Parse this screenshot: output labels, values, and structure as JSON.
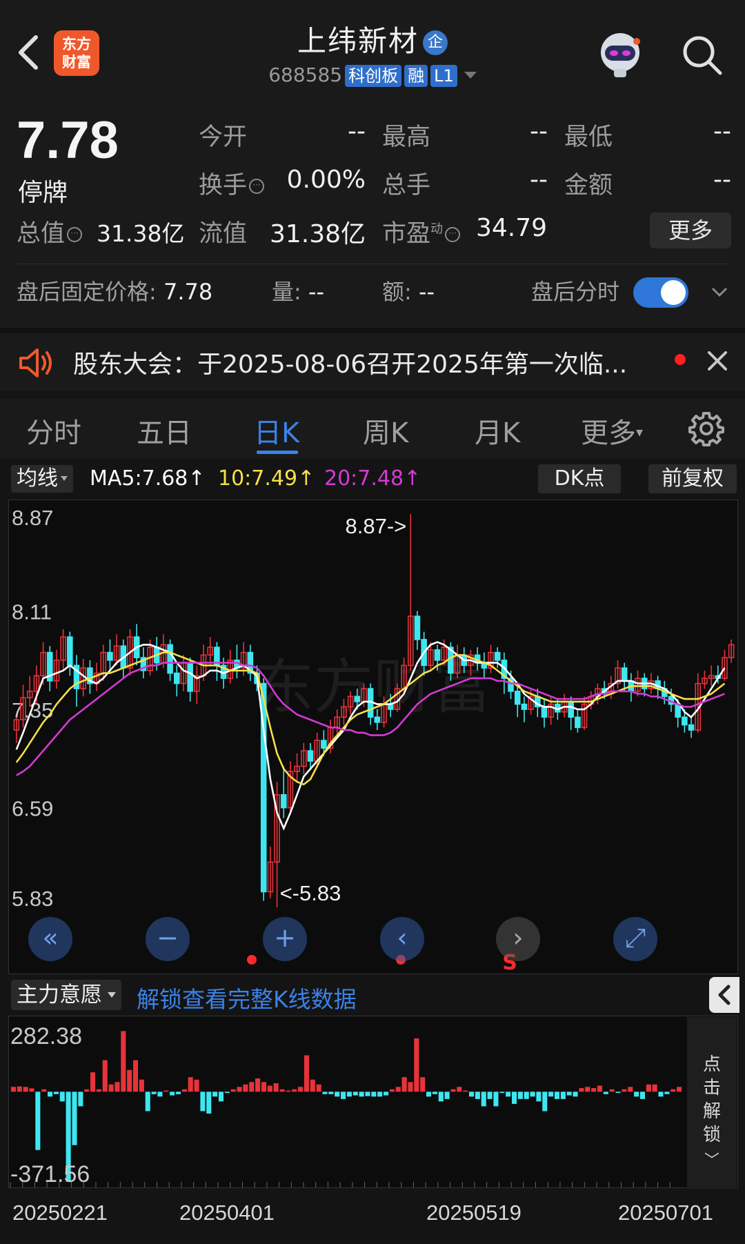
{
  "header": {
    "title": "上纬新材",
    "title_badge": "企",
    "code": "688585",
    "tags": [
      "科创板",
      "融",
      "L1"
    ],
    "logo_text_line1": "东方",
    "logo_text_line2": "财富"
  },
  "quote": {
    "price": "7.78",
    "status": "停牌",
    "fields": {
      "open_label": "今开",
      "open_value": "--",
      "high_label": "最高",
      "high_value": "--",
      "low_label": "最低",
      "low_value": "--",
      "turnover_label": "换手",
      "turnover_value": "0.00%",
      "volume_label": "总手",
      "volume_value": "--",
      "amount_label": "金额",
      "amount_value": "--",
      "mcap_label": "总值",
      "mcap_value": "31.38亿",
      "float_label": "流值",
      "float_value": "31.38亿",
      "pe_label": "市盈",
      "pe_sup": "动",
      "pe_value": "34.79"
    },
    "more_label": "更多",
    "after_hours": {
      "price_label": "盘后固定价格:",
      "price_value": "7.78",
      "vol_label": "量:",
      "vol_value": "--",
      "amt_label": "额:",
      "amt_value": "--",
      "timeshare_label": "盘后分时",
      "toggle_on": true
    }
  },
  "notice": {
    "text": "股东大会：于2025-08-06召开2025年第一次临...",
    "unread_color": "#ff2020"
  },
  "tabs": [
    {
      "label": "分时",
      "active": false
    },
    {
      "label": "五日",
      "active": false
    },
    {
      "label": "日K",
      "active": true
    },
    {
      "label": "周K",
      "active": false
    },
    {
      "label": "月K",
      "active": false
    },
    {
      "label": "更多",
      "active": false
    }
  ],
  "chart_toolbar": {
    "ma_button": "均线",
    "ma5": "MA5:7.68↑",
    "ma10": "10:7.49↑",
    "ma20": "20:7.48↑",
    "ma5_color": "#ffffff",
    "ma10_color": "#f5e04a",
    "ma20_color": "#d43ad4",
    "dk_button": "DK点",
    "adjust_button": "前复权"
  },
  "kline": {
    "y_labels": [
      "8.87",
      "8.11",
      "7.35",
      "6.59",
      "5.83"
    ],
    "max_marker": "8.87->",
    "min_marker": "<-5.83",
    "watermark": "东方财富",
    "up_color": "#e8333a",
    "down_color": "#3ee6f0"
  },
  "indicator": {
    "name": "主力意愿",
    "unlock_text": "解锁查看完整K线数据",
    "y_max": "282.38",
    "y_min": "-371.56",
    "side_text": "点击解锁"
  },
  "dates": [
    "20250221",
    "20250401",
    "20250519",
    "20250701"
  ],
  "chart_data": {
    "type": "candlestick",
    "y_range": [
      5.83,
      8.87
    ],
    "candles": [
      [
        7.2,
        7.28,
        7.3,
        7.1
      ],
      [
        7.28,
        7.45,
        7.55,
        7.22
      ],
      [
        7.45,
        7.5,
        7.62,
        7.38
      ],
      [
        7.5,
        7.62,
        7.7,
        7.4
      ],
      [
        7.62,
        7.8,
        7.88,
        7.55
      ],
      [
        7.8,
        7.58,
        7.85,
        7.5
      ],
      [
        7.58,
        7.74,
        7.82,
        7.52
      ],
      [
        7.74,
        7.92,
        7.98,
        7.66
      ],
      [
        7.92,
        7.7,
        7.96,
        7.62
      ],
      [
        7.7,
        7.52,
        7.78,
        7.38
      ],
      [
        7.52,
        7.68,
        7.75,
        7.46
      ],
      [
        7.68,
        7.56,
        7.74,
        7.48
      ],
      [
        7.56,
        7.64,
        7.72,
        7.5
      ],
      [
        7.64,
        7.8,
        7.86,
        7.58
      ],
      [
        7.8,
        7.74,
        7.9,
        7.66
      ],
      [
        7.74,
        7.85,
        7.94,
        7.7
      ],
      [
        7.85,
        7.68,
        7.9,
        7.6
      ],
      [
        7.68,
        7.92,
        7.98,
        7.62
      ],
      [
        7.92,
        7.76,
        8.02,
        7.7
      ],
      [
        7.76,
        7.66,
        7.84,
        7.6
      ],
      [
        7.66,
        7.84,
        7.9,
        7.62
      ],
      [
        7.84,
        7.72,
        7.92,
        7.66
      ],
      [
        7.72,
        7.86,
        7.94,
        7.68
      ],
      [
        7.86,
        7.64,
        7.9,
        7.58
      ],
      [
        7.64,
        7.56,
        7.7,
        7.46
      ],
      [
        7.56,
        7.72,
        7.78,
        7.5
      ],
      [
        7.72,
        7.5,
        7.76,
        7.42
      ],
      [
        7.5,
        7.62,
        7.7,
        7.4
      ],
      [
        7.62,
        7.78,
        7.86,
        7.58
      ],
      [
        7.78,
        7.84,
        7.92,
        7.7
      ],
      [
        7.84,
        7.7,
        7.88,
        7.58
      ],
      [
        7.7,
        7.6,
        7.76,
        7.52
      ],
      [
        7.6,
        7.74,
        7.82,
        7.56
      ],
      [
        7.74,
        7.68,
        7.86,
        7.6
      ],
      [
        7.68,
        7.8,
        7.88,
        7.62
      ],
      [
        7.8,
        7.64,
        7.86,
        7.58
      ],
      [
        7.64,
        7.56,
        7.7,
        7.5
      ],
      [
        7.56,
        5.95,
        7.6,
        5.88
      ],
      [
        5.95,
        6.18,
        6.3,
        5.9
      ],
      [
        6.18,
        6.7,
        6.8,
        5.83
      ],
      [
        6.7,
        6.6,
        6.92,
        6.52
      ],
      [
        6.6,
        6.88,
        6.96,
        6.56
      ],
      [
        6.88,
        6.92,
        7.02,
        6.8
      ],
      [
        6.92,
        7.04,
        7.1,
        6.86
      ],
      [
        7.04,
        6.96,
        7.1,
        6.9
      ],
      [
        6.96,
        7.12,
        7.18,
        6.92
      ],
      [
        7.12,
        7.06,
        7.2,
        7.0
      ],
      [
        7.06,
        7.22,
        7.28,
        7.02
      ],
      [
        7.22,
        7.3,
        7.36,
        7.16
      ],
      [
        7.3,
        7.38,
        7.44,
        7.24
      ],
      [
        7.38,
        7.46,
        7.5,
        7.32
      ],
      [
        7.46,
        7.42,
        7.52,
        7.36
      ],
      [
        7.42,
        7.52,
        7.56,
        7.38
      ],
      [
        7.52,
        7.3,
        7.56,
        7.24
      ],
      [
        7.3,
        7.26,
        7.36,
        7.2
      ],
      [
        7.26,
        7.4,
        7.46,
        7.22
      ],
      [
        7.4,
        7.36,
        7.48,
        7.3
      ],
      [
        7.36,
        7.52,
        7.56,
        7.34
      ],
      [
        7.52,
        7.7,
        7.76,
        7.48
      ],
      [
        7.7,
        8.08,
        8.87,
        7.66
      ],
      [
        8.08,
        7.9,
        8.12,
        7.82
      ],
      [
        7.9,
        7.7,
        7.96,
        7.62
      ],
      [
        7.7,
        7.82,
        7.88,
        7.66
      ],
      [
        7.82,
        7.74,
        7.86,
        7.66
      ],
      [
        7.74,
        7.84,
        7.9,
        7.7
      ],
      [
        7.84,
        7.64,
        7.88,
        7.58
      ],
      [
        7.64,
        7.78,
        7.86,
        7.6
      ],
      [
        7.78,
        7.7,
        7.84,
        7.64
      ],
      [
        7.7,
        7.78,
        7.82,
        7.62
      ],
      [
        7.78,
        7.72,
        7.84,
        7.66
      ],
      [
        7.72,
        7.68,
        7.8,
        7.6
      ],
      [
        7.68,
        7.8,
        7.86,
        7.64
      ],
      [
        7.8,
        7.74,
        7.84,
        7.68
      ],
      [
        7.74,
        7.6,
        7.8,
        7.48
      ],
      [
        7.6,
        7.5,
        7.66,
        7.44
      ],
      [
        7.5,
        7.4,
        7.56,
        7.3
      ],
      [
        7.4,
        7.36,
        7.46,
        7.26
      ],
      [
        7.36,
        7.46,
        7.52,
        7.32
      ],
      [
        7.46,
        7.38,
        7.52,
        7.3
      ],
      [
        7.38,
        7.3,
        7.44,
        7.22
      ],
      [
        7.3,
        7.4,
        7.46,
        7.24
      ],
      [
        7.4,
        7.34,
        7.44,
        7.28
      ],
      [
        7.34,
        7.42,
        7.48,
        7.3
      ],
      [
        7.42,
        7.3,
        7.46,
        7.2
      ],
      [
        7.3,
        7.22,
        7.36,
        7.18
      ],
      [
        7.22,
        7.4,
        7.46,
        7.2
      ],
      [
        7.4,
        7.46,
        7.5,
        7.36
      ],
      [
        7.46,
        7.52,
        7.56,
        7.4
      ],
      [
        7.52,
        7.48,
        7.58,
        7.44
      ],
      [
        7.48,
        7.56,
        7.62,
        7.44
      ],
      [
        7.56,
        7.68,
        7.74,
        7.52
      ],
      [
        7.68,
        7.58,
        7.72,
        7.5
      ],
      [
        7.58,
        7.5,
        7.64,
        7.42
      ],
      [
        7.5,
        7.6,
        7.66,
        7.46
      ],
      [
        7.6,
        7.52,
        7.64,
        7.46
      ],
      [
        7.52,
        7.58,
        7.64,
        7.48
      ],
      [
        7.58,
        7.52,
        7.62,
        7.44
      ],
      [
        7.52,
        7.46,
        7.58,
        7.4
      ],
      [
        7.46,
        7.4,
        7.52,
        7.34
      ],
      [
        7.4,
        7.3,
        7.44,
        7.22
      ],
      [
        7.3,
        7.24,
        7.36,
        7.18
      ],
      [
        7.24,
        7.2,
        7.3,
        7.14
      ],
      [
        7.2,
        7.56,
        7.64,
        7.18
      ],
      [
        7.56,
        7.6,
        7.66,
        7.52
      ],
      [
        7.6,
        7.62,
        7.7,
        7.54
      ],
      [
        7.62,
        7.6,
        7.7,
        7.56
      ],
      [
        7.6,
        7.76,
        7.82,
        7.58
      ],
      [
        7.76,
        7.86,
        7.9,
        7.72
      ]
    ],
    "ma_lines": {
      "MA5": [
        7.05,
        7.18,
        7.32,
        7.46,
        7.6,
        7.62,
        7.64,
        7.66,
        7.7,
        7.66,
        7.62,
        7.58,
        7.56,
        7.6,
        7.66,
        7.72,
        7.76,
        7.8,
        7.84,
        7.86,
        7.86,
        7.84,
        7.82,
        7.8,
        7.72,
        7.66,
        7.64,
        7.6,
        7.62,
        7.66,
        7.66,
        7.64,
        7.66,
        7.68,
        7.7,
        7.66,
        7.62,
        7.2,
        6.82,
        6.56,
        6.44,
        6.56,
        6.7,
        6.84,
        6.9,
        6.96,
        7.02,
        7.08,
        7.14,
        7.2,
        7.3,
        7.38,
        7.42,
        7.42,
        7.4,
        7.4,
        7.4,
        7.42,
        7.48,
        7.6,
        7.72,
        7.8,
        7.86,
        7.88,
        7.86,
        7.82,
        7.78,
        7.74,
        7.74,
        7.72,
        7.72,
        7.72,
        7.72,
        7.68,
        7.62,
        7.56,
        7.48,
        7.44,
        7.4,
        7.38,
        7.38,
        7.36,
        7.38,
        7.38,
        7.36,
        7.36,
        7.4,
        7.46,
        7.5,
        7.54,
        7.58,
        7.58,
        7.58,
        7.56,
        7.56,
        7.56,
        7.54,
        7.52,
        7.48,
        7.42,
        7.34,
        7.3,
        7.36,
        7.44,
        7.52,
        7.6,
        7.68
      ],
      "MA10": [
        6.95,
        7.02,
        7.1,
        7.18,
        7.26,
        7.32,
        7.4,
        7.46,
        7.52,
        7.56,
        7.58,
        7.6,
        7.62,
        7.64,
        7.64,
        7.66,
        7.68,
        7.7,
        7.72,
        7.74,
        7.76,
        7.78,
        7.8,
        7.8,
        7.78,
        7.76,
        7.74,
        7.72,
        7.7,
        7.7,
        7.7,
        7.68,
        7.66,
        7.66,
        7.66,
        7.66,
        7.64,
        7.44,
        7.22,
        7.02,
        6.9,
        6.84,
        6.8,
        6.78,
        6.82,
        6.92,
        7.02,
        7.1,
        7.16,
        7.22,
        7.28,
        7.32,
        7.34,
        7.36,
        7.38,
        7.4,
        7.44,
        7.48,
        7.52,
        7.56,
        7.6,
        7.64,
        7.66,
        7.7,
        7.72,
        7.76,
        7.78,
        7.78,
        7.76,
        7.74,
        7.72,
        7.7,
        7.66,
        7.62,
        7.58,
        7.54,
        7.5,
        7.48,
        7.46,
        7.44,
        7.42,
        7.42,
        7.42,
        7.42,
        7.42,
        7.42,
        7.42,
        7.44,
        7.46,
        7.48,
        7.5,
        7.52,
        7.54,
        7.54,
        7.54,
        7.54,
        7.52,
        7.5,
        7.48,
        7.46,
        7.44,
        7.44,
        7.44,
        7.46,
        7.48,
        7.52,
        7.56
      ],
      "MA20": [
        6.85,
        6.88,
        6.92,
        6.98,
        7.04,
        7.1,
        7.16,
        7.22,
        7.28,
        7.32,
        7.36,
        7.4,
        7.44,
        7.48,
        7.52,
        7.56,
        7.6,
        7.64,
        7.66,
        7.68,
        7.7,
        7.7,
        7.72,
        7.72,
        7.72,
        7.72,
        7.72,
        7.72,
        7.72,
        7.72,
        7.72,
        7.72,
        7.72,
        7.72,
        7.7,
        7.7,
        7.68,
        7.62,
        7.54,
        7.46,
        7.4,
        7.36,
        7.32,
        7.3,
        7.28,
        7.26,
        7.24,
        7.22,
        7.22,
        7.2,
        7.2,
        7.18,
        7.18,
        7.16,
        7.16,
        7.16,
        7.18,
        7.22,
        7.28,
        7.34,
        7.4,
        7.44,
        7.48,
        7.5,
        7.52,
        7.54,
        7.56,
        7.58,
        7.6,
        7.6,
        7.6,
        7.6,
        7.58,
        7.58,
        7.56,
        7.56,
        7.54,
        7.52,
        7.5,
        7.48,
        7.46,
        7.44,
        7.44,
        7.44,
        7.44,
        7.44,
        7.46,
        7.48,
        7.48,
        7.5,
        7.5,
        7.5,
        7.5,
        7.48,
        7.48,
        7.46,
        7.46,
        7.44,
        7.42,
        7.4,
        7.38,
        7.38,
        7.4,
        7.42,
        7.44,
        7.46,
        7.48
      ]
    },
    "volume_like": {
      "name": "主力意愿",
      "range": [
        -371.56,
        282.38
      ],
      "values": [
        20,
        22,
        20,
        14,
        -240,
        10,
        -20,
        -10,
        -40,
        -371,
        -220,
        -60,
        10,
        80,
        10,
        130,
        30,
        40,
        250,
        90,
        130,
        50,
        -80,
        -10,
        -20,
        5,
        -15,
        -10,
        10,
        60,
        50,
        -80,
        -90,
        -20,
        -40,
        -5,
        10,
        20,
        30,
        40,
        55,
        40,
        25,
        35,
        10,
        5,
        10,
        20,
        150,
        50,
        30,
        -10,
        -10,
        -20,
        -30,
        -20,
        -15,
        -20,
        -18,
        -20,
        -20,
        -15,
        10,
        20,
        60,
        40,
        220,
        60,
        -20,
        -10,
        -40,
        -30,
        10,
        20,
        5,
        -20,
        -30,
        -60,
        -30,
        -60,
        -5,
        -20,
        -50,
        -30,
        -30,
        -20,
        -40,
        -80,
        -20,
        -30,
        -30,
        -15,
        -20,
        15,
        20,
        15,
        25,
        -10,
        10,
        -5,
        10,
        20,
        -20,
        -30,
        30,
        30,
        -20,
        -10,
        10,
        20
      ]
    },
    "x_labels": [
      "20250221",
      "20250401",
      "20250519",
      "20250701"
    ]
  }
}
